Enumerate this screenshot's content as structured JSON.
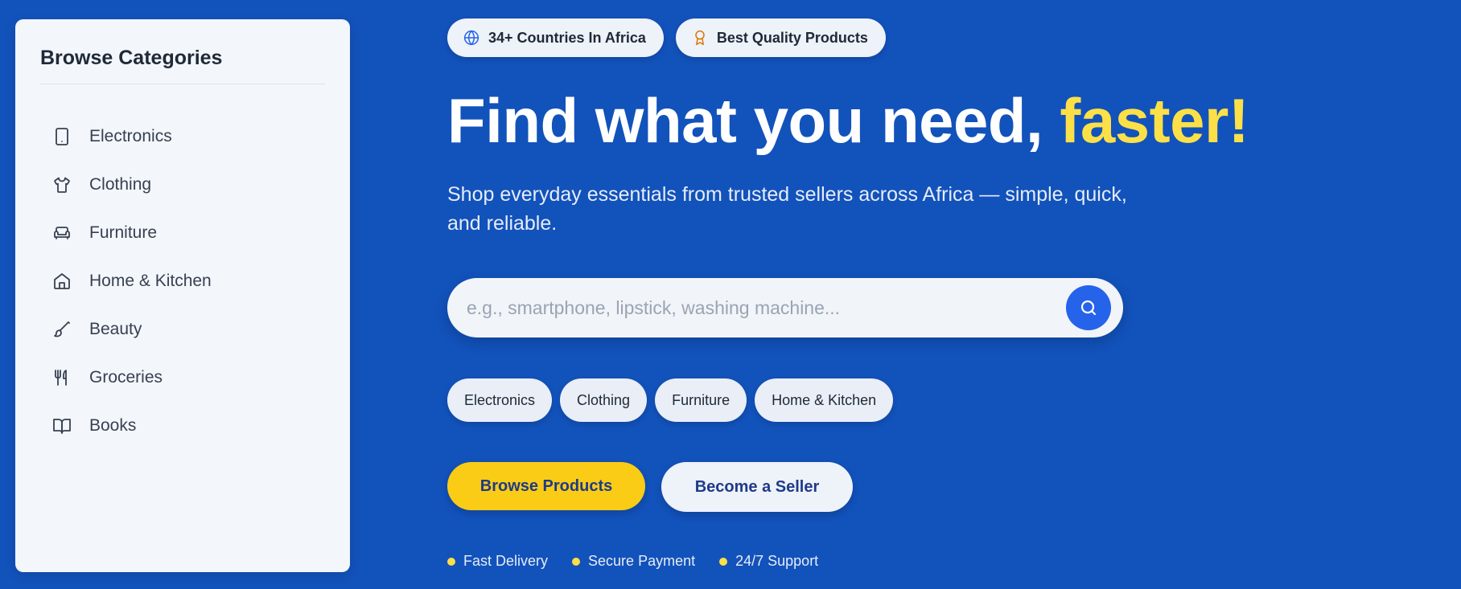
{
  "sidebar": {
    "title": "Browse Categories",
    "items": [
      {
        "label": "Electronics",
        "icon": "tablet-icon"
      },
      {
        "label": "Clothing",
        "icon": "shirt-icon"
      },
      {
        "label": "Furniture",
        "icon": "sofa-icon"
      },
      {
        "label": "Home & Kitchen",
        "icon": "home-icon"
      },
      {
        "label": "Beauty",
        "icon": "brush-icon"
      },
      {
        "label": "Groceries",
        "icon": "utensils-icon"
      },
      {
        "label": "Books",
        "icon": "book-open-icon"
      }
    ]
  },
  "badges": [
    {
      "label": "34+ Countries In Africa",
      "icon": "globe-icon",
      "icon_color": "#2563eb"
    },
    {
      "label": "Best Quality Products",
      "icon": "award-icon",
      "icon_color": "#d97706"
    }
  ],
  "hero": {
    "headline_main": "Find what you need, ",
    "headline_accent": "faster!",
    "subtitle": "Shop everyday essentials from trusted sellers across Africa — simple, quick, and reliable."
  },
  "search": {
    "placeholder": "e.g., smartphone, lipstick, washing machine...",
    "value": "",
    "button_icon": "search-icon"
  },
  "quick_chips": [
    "Electronics",
    "Clothing",
    "Furniture",
    "Home & Kitchen"
  ],
  "cta": {
    "primary_label": "Browse Products",
    "secondary_label": "Become a Seller"
  },
  "features": [
    "Fast Delivery",
    "Secure Payment",
    "24/7 Support"
  ],
  "colors": {
    "background": "#1252bb",
    "accent_yellow": "#fde047",
    "primary_button": "#facc15",
    "search_button": "#2563eb"
  }
}
